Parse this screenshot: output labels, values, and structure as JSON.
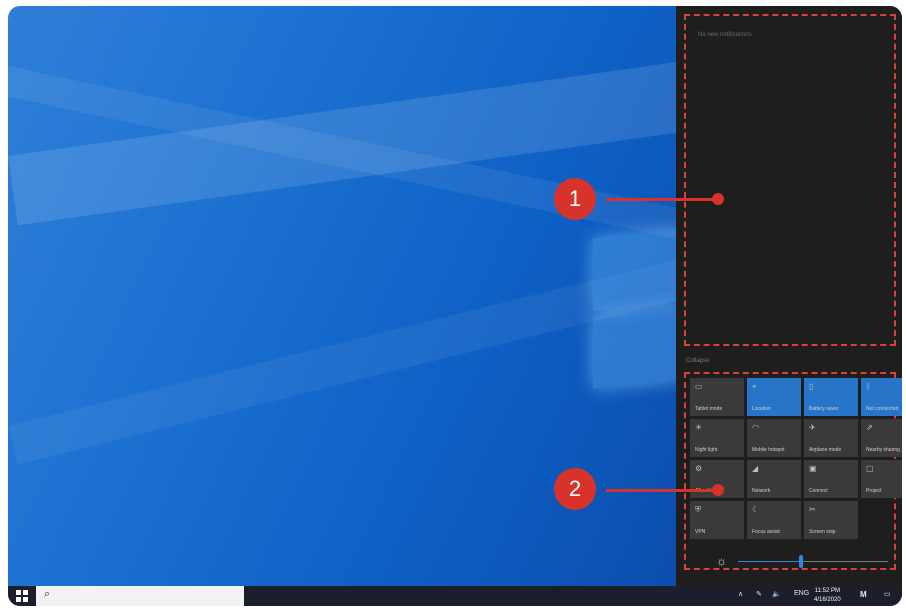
{
  "notifications": {
    "empty_text": "No new notifications"
  },
  "action_center": {
    "collapse_label": "Collapse",
    "tiles": [
      {
        "label": "Tablet mode",
        "icon": "tablet-icon",
        "active": false
      },
      {
        "label": "Location",
        "icon": "location-icon",
        "active": true
      },
      {
        "label": "Battery saver",
        "icon": "battery-icon",
        "active": true
      },
      {
        "label": "Not connected",
        "icon": "bluetooth-icon",
        "active": true
      },
      {
        "label": "Night light",
        "icon": "night-light-icon",
        "active": false
      },
      {
        "label": "Mobile hotspot",
        "icon": "hotspot-icon",
        "active": false
      },
      {
        "label": "Airplane mode",
        "icon": "airplane-icon",
        "active": false
      },
      {
        "label": "Nearby sharing",
        "icon": "share-icon",
        "active": false
      },
      {
        "label": "All settings",
        "icon": "gear-icon",
        "active": false
      },
      {
        "label": "Network",
        "icon": "network-icon",
        "active": false
      },
      {
        "label": "Connect",
        "icon": "connect-icon",
        "active": false
      },
      {
        "label": "Project",
        "icon": "project-icon",
        "active": false
      },
      {
        "label": "VPN",
        "icon": "vpn-icon",
        "active": false
      },
      {
        "label": "Focus assist",
        "icon": "moon-icon",
        "active": false
      },
      {
        "label": "Screen snip",
        "icon": "snip-icon",
        "active": false
      }
    ],
    "brightness": 0.42
  },
  "callouts": [
    {
      "number": "1"
    },
    {
      "number": "2"
    }
  ],
  "taskbar": {
    "tray": {
      "language": "ENG"
    },
    "clock": {
      "time": "11:52 PM",
      "date": "4/16/2020"
    }
  },
  "icons": {
    "start": "windows-start-icon",
    "search": "search-icon",
    "brightness": "sun-icon"
  }
}
